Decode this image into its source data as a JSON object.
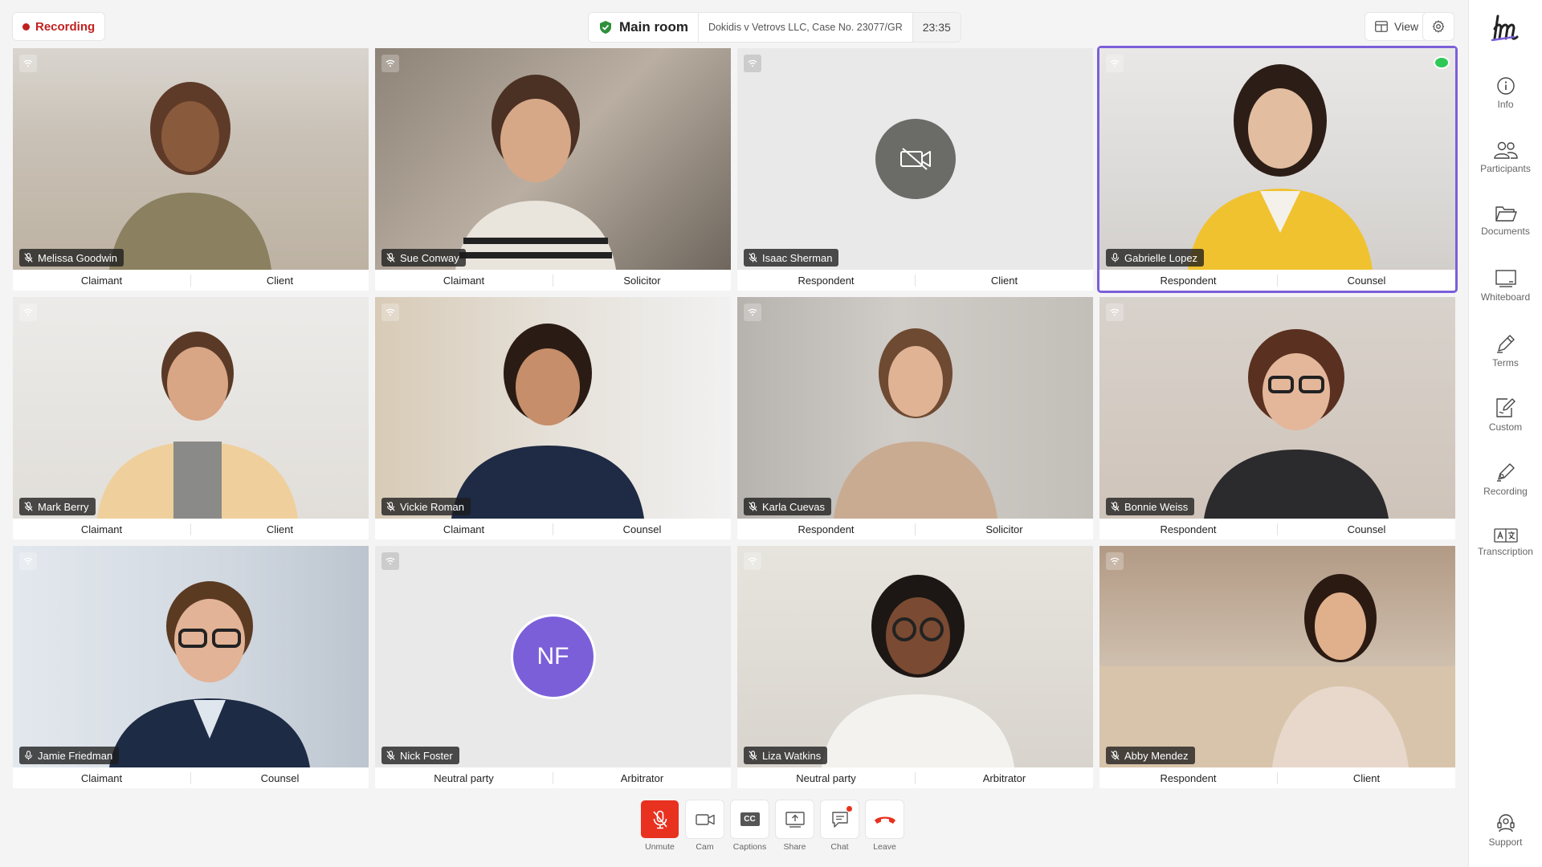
{
  "topbar": {
    "recording_label": "Recording",
    "room_name": "Main room",
    "case_text": "Dokidis v Vetrovs LLC, Case No. 23077/GR",
    "timer": "23:35",
    "view_label": "View"
  },
  "tiles": [
    {
      "name": "Melissa Goodwin",
      "role1": "Claimant",
      "role2": "Client"
    },
    {
      "name": "Sue Conway",
      "role1": "Claimant",
      "role2": "Solicitor"
    },
    {
      "name": "Isaac Sherman",
      "role1": "Respondent",
      "role2": "Client"
    },
    {
      "name": "Gabrielle Lopez",
      "role1": "Respondent",
      "role2": "Counsel"
    },
    {
      "name": "Mark Berry",
      "role1": "Claimant",
      "role2": "Client"
    },
    {
      "name": "Vickie Roman",
      "role1": "Claimant",
      "role2": "Counsel"
    },
    {
      "name": "Karla Cuevas",
      "role1": "Respondent",
      "role2": "Solicitor"
    },
    {
      "name": "Bonnie Weiss",
      "role1": "Respondent",
      "role2": "Counsel"
    },
    {
      "name": "Jamie Friedman",
      "role1": "Claimant",
      "role2": "Counsel"
    },
    {
      "name": "Nick Foster",
      "role1": "Neutral party",
      "role2": "Arbitrator",
      "initials": "NF"
    },
    {
      "name": "Liza Watkins",
      "role1": "Neutral party",
      "role2": "Arbitrator"
    },
    {
      "name": "Abby Mendez",
      "role1": "Respondent",
      "role2": "Client"
    }
  ],
  "controls": {
    "unmute": "Unmute",
    "cam": "Cam",
    "captions": "Captions",
    "captions_glyph": "CC",
    "share": "Share",
    "chat": "Chat",
    "leave": "Leave"
  },
  "sidebar": {
    "info": "Info",
    "participants": "Participants",
    "documents": "Documents",
    "whiteboard": "Whiteboard",
    "terms": "Terms",
    "custom": "Custom",
    "recording": "Recording",
    "transcription": "Transcription",
    "support": "Support"
  },
  "colors": {
    "accent": "#7b5fd9",
    "recording_red": "#c0211f",
    "unmute_red": "#e8311f",
    "speaking_green": "#2ec856"
  }
}
